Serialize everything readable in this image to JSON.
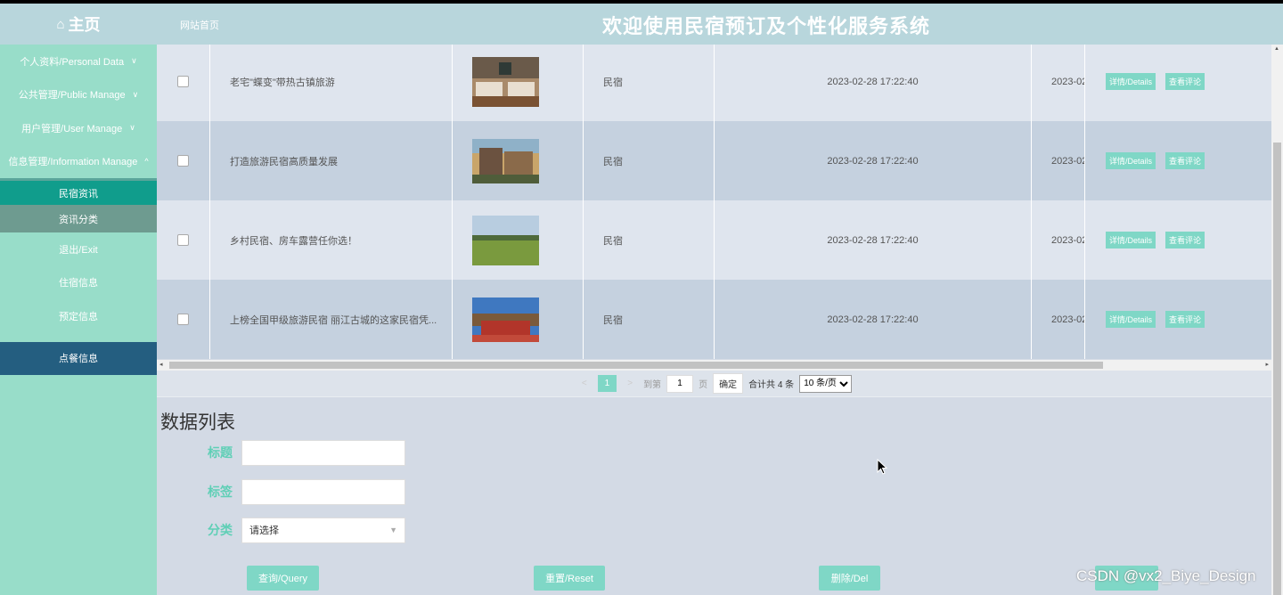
{
  "header": {
    "home_label": "主页",
    "site_link": "网站首页",
    "system_title": "欢迎使用民宿预订及个性化服务系统"
  },
  "sidebar": {
    "items": [
      {
        "label": "个人资料/Personal Data",
        "arrow": "∨"
      },
      {
        "label": "公共管理/Public Manage",
        "arrow": "∨"
      },
      {
        "label": "用户管理/User Manage",
        "arrow": "∨"
      },
      {
        "label": "信息管理/Information Manage",
        "arrow": "^"
      },
      {
        "label": "民宿资讯"
      },
      {
        "label": "资讯分类"
      },
      {
        "label": "退出/Exit"
      },
      {
        "label": "住宿信息"
      },
      {
        "label": "预定信息"
      },
      {
        "label": "点餐信息"
      }
    ]
  },
  "table": {
    "rows": [
      {
        "title": "老宅\"蝶变\"带热古镇旅游",
        "type": "民宿",
        "time": "2023-02-28 17:22:40",
        "time2": "2023-02",
        "detail": "详情/Details",
        "comment": "查看评论"
      },
      {
        "title": "打造旅游民宿高质量发展",
        "type": "民宿",
        "time": "2023-02-28 17:22:40",
        "time2": "2023-02",
        "detail": "详情/Details",
        "comment": "查看评论"
      },
      {
        "title": "乡村民宿、房车露营任你选！",
        "type": "民宿",
        "time": "2023-02-28 17:22:40",
        "time2": "2023-02",
        "detail": "详情/Details",
        "comment": "查看评论"
      },
      {
        "title": "上榜全国甲级旅游民宿 丽江古城的这家民宿凭...",
        "type": "民宿",
        "time": "2023-02-28 17:22:40",
        "time2": "2023-02",
        "detail": "详情/Details",
        "comment": "查看评论"
      }
    ]
  },
  "pager": {
    "prev": "<",
    "current_page": "1",
    "next": ">",
    "goto_label": "到第",
    "page_input": "1",
    "page_unit": "页",
    "confirm": "确定",
    "total": "合计共 4 条",
    "page_size": "10 条/页"
  },
  "form": {
    "title": "数据列表",
    "label_title": "标题",
    "label_tag": "标签",
    "label_category": "分类",
    "category_placeholder": "请选择",
    "query": "查询/Query",
    "reset": "重置/Reset",
    "delete": "删除/Del"
  },
  "watermark": "CSDN @vx2_Biye_Design",
  "colors": {
    "accent": "#7fd7c6",
    "sidebar": "#98ddc9",
    "header": "#b8d6dc"
  }
}
